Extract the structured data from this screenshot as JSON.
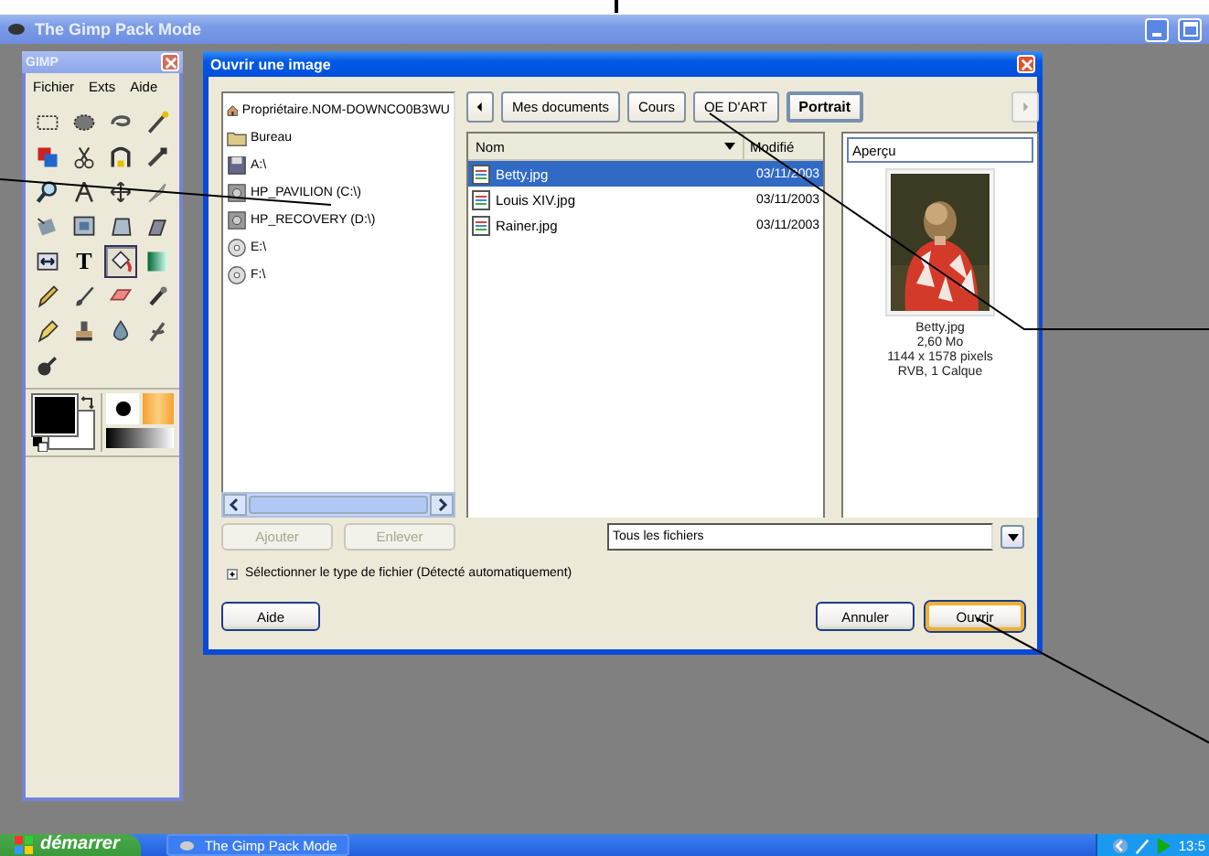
{
  "window": {
    "title": "The Gimp Pack Mode"
  },
  "toolbox": {
    "title": "GIMP",
    "menu": [
      "Fichier",
      "Exts",
      "Aide"
    ],
    "tools": [
      {
        "selected": false
      },
      {
        "selected": false
      },
      {
        "selected": false
      },
      {
        "selected": false
      },
      {
        "selected": false
      },
      {
        "selected": false
      },
      {
        "selected": false
      },
      {
        "selected": false
      },
      {
        "selected": false
      },
      {
        "selected": false
      },
      {
        "selected": false
      },
      {
        "selected": false
      },
      {
        "selected": false
      },
      {
        "selected": false
      },
      {
        "selected": false
      },
      {
        "selected": false
      },
      {
        "selected": false
      },
      {
        "selected": false,
        "glyph": "T"
      },
      {
        "selected": true
      },
      {
        "selected": false
      },
      {
        "selected": false
      },
      {
        "selected": false
      },
      {
        "selected": false
      },
      {
        "selected": false
      },
      {
        "selected": false
      },
      {
        "selected": false
      },
      {
        "selected": false
      },
      {
        "selected": false
      },
      {
        "selected": false
      }
    ]
  },
  "dialog": {
    "title": "Ouvrir une image",
    "places": [
      {
        "kind": "home",
        "label": "Propriétaire.NOM-DOWNCO0B3WU"
      },
      {
        "kind": "folder",
        "label": "Bureau"
      },
      {
        "kind": "floppy",
        "label": "A:\\"
      },
      {
        "kind": "disk",
        "label": "HP_PAVILION (C:\\)"
      },
      {
        "kind": "disk",
        "label": "HP_RECOVERY (D:\\)"
      },
      {
        "kind": "cd",
        "label": "E:\\"
      },
      {
        "kind": "cd",
        "label": "F:\\"
      }
    ],
    "path": [
      {
        "label": "Mes documents",
        "selected": false
      },
      {
        "label": "Cours",
        "selected": false
      },
      {
        "label": "OE D'ART",
        "selected": false
      },
      {
        "label": "Portrait",
        "selected": true
      }
    ],
    "columns": [
      "Nom",
      "Modifié"
    ],
    "files": [
      {
        "name": "Betty.jpg",
        "modified": "03/11/2003",
        "selected": true
      },
      {
        "name": "Louis XIV.jpg",
        "modified": "03/11/2003",
        "selected": false
      },
      {
        "name": "Rainer.jpg",
        "modified": "03/11/2003",
        "selected": false
      }
    ],
    "preview": {
      "header": "Aperçu",
      "lines": [
        "Betty.jpg",
        "2,60 Mo",
        "1144 x 1578 pixels",
        "RVB, 1 Calque"
      ]
    },
    "add": {
      "label": "Ajouter",
      "disabled": true
    },
    "remove": {
      "label": "Enlever",
      "disabled": true
    },
    "filter": "Tous les fichiers",
    "expander": {
      "label": "Sélectionner le type de fichier (Détecté automatiquement)",
      "expanded": false
    },
    "buttons": [
      {
        "label": "Aide",
        "default": false
      },
      {
        "label": "Annuler",
        "default": false
      },
      {
        "label": "Ouvrir",
        "default": true
      }
    ]
  },
  "taskbar": {
    "start": "démarrer",
    "task": "The Gimp Pack Mode",
    "clock": "13:5"
  }
}
